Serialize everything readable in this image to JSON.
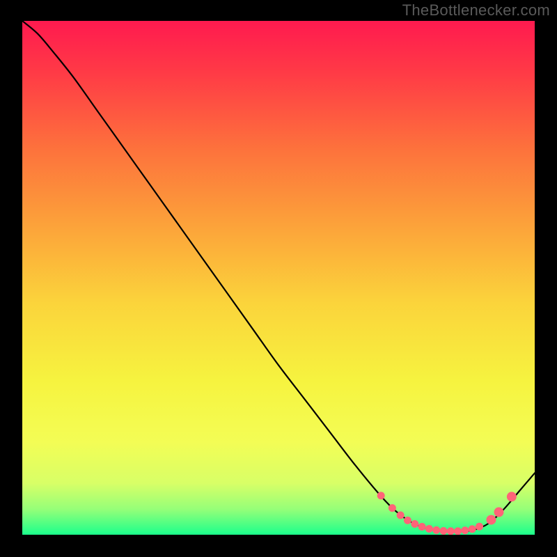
{
  "watermark": "TheBottlenecker.com",
  "chart_data": {
    "type": "line",
    "title": "",
    "xlabel": "",
    "ylabel": "",
    "xlim": [
      0,
      100
    ],
    "ylim": [
      0,
      100
    ],
    "background_gradient": [
      {
        "offset": 0.0,
        "color": "#ff1a4f"
      },
      {
        "offset": 0.1,
        "color": "#ff3a46"
      },
      {
        "offset": 0.25,
        "color": "#fd723c"
      },
      {
        "offset": 0.4,
        "color": "#fca33a"
      },
      {
        "offset": 0.55,
        "color": "#fbd43b"
      },
      {
        "offset": 0.7,
        "color": "#f6f33f"
      },
      {
        "offset": 0.82,
        "color": "#f3fd55"
      },
      {
        "offset": 0.9,
        "color": "#d8ff67"
      },
      {
        "offset": 0.95,
        "color": "#96ff78"
      },
      {
        "offset": 1.0,
        "color": "#1bff8c"
      }
    ],
    "series": [
      {
        "name": "curve",
        "color": "#000000",
        "x": [
          0,
          3,
          6,
          10,
          15,
          20,
          25,
          30,
          35,
          40,
          45,
          50,
          55,
          60,
          65,
          70,
          73,
          76,
          79,
          82,
          85,
          88,
          91,
          94,
          97,
          100
        ],
        "y": [
          100,
          97.5,
          94,
          89,
          82,
          75,
          68,
          61,
          54,
          47,
          40,
          33,
          26.5,
          20,
          13.5,
          7.5,
          4.5,
          2.4,
          1.2,
          0.7,
          0.6,
          0.9,
          2.2,
          5.0,
          8.5,
          12
        ]
      }
    ],
    "marker_points": {
      "color": "#ff6478",
      "radius_small": 5.5,
      "radius_large": 7,
      "points": [
        {
          "x": 70.0,
          "y": 7.6,
          "r": "small"
        },
        {
          "x": 72.2,
          "y": 5.2,
          "r": "small"
        },
        {
          "x": 73.8,
          "y": 3.8,
          "r": "small"
        },
        {
          "x": 75.2,
          "y": 2.8,
          "r": "small"
        },
        {
          "x": 76.6,
          "y": 2.1,
          "r": "small"
        },
        {
          "x": 78.0,
          "y": 1.55,
          "r": "small"
        },
        {
          "x": 79.4,
          "y": 1.15,
          "r": "small"
        },
        {
          "x": 80.8,
          "y": 0.9,
          "r": "small"
        },
        {
          "x": 82.2,
          "y": 0.75,
          "r": "small"
        },
        {
          "x": 83.6,
          "y": 0.7,
          "r": "small"
        },
        {
          "x": 85.0,
          "y": 0.7,
          "r": "small"
        },
        {
          "x": 86.4,
          "y": 0.85,
          "r": "small"
        },
        {
          "x": 87.8,
          "y": 1.1,
          "r": "small"
        },
        {
          "x": 89.2,
          "y": 1.6,
          "r": "small"
        },
        {
          "x": 91.5,
          "y": 2.9,
          "r": "large"
        },
        {
          "x": 93.0,
          "y": 4.4,
          "r": "large"
        },
        {
          "x": 95.5,
          "y": 7.4,
          "r": "large"
        }
      ]
    }
  }
}
